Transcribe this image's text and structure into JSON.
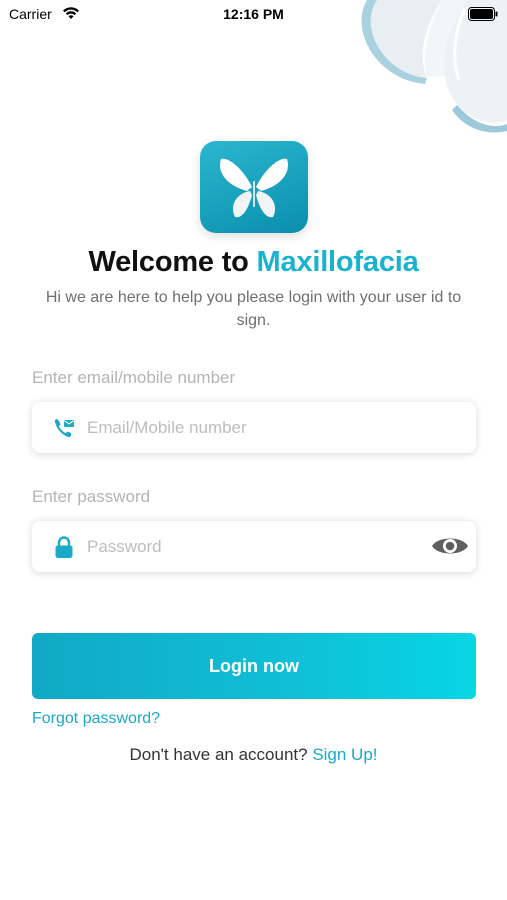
{
  "status_bar": {
    "carrier": "Carrier",
    "time": "12:16 PM"
  },
  "header": {
    "welcome_prefix": "Welcome to ",
    "brand_name": "Maxillofacia",
    "subtitle": "Hi we are here to help you please login with your user id to sign."
  },
  "form": {
    "email_label": "Enter email/mobile number",
    "email_placeholder": "Email/Mobile number",
    "email_value": "",
    "password_label": "Enter password",
    "password_placeholder": "Password",
    "password_value": "",
    "login_button": "Login now",
    "forgot_password": "Forgot password?"
  },
  "footer": {
    "no_account_text": "Don't have an account?",
    "signup_link": "Sign Up!"
  },
  "icons": {
    "email": "phone-mail-icon",
    "password": "lock-icon",
    "visibility": "eye-icon",
    "logo": "butterfly-icon"
  },
  "colors": {
    "accent": "#1ab3cf",
    "link": "#1aa9c6",
    "button_start": "#11a9c5",
    "button_end": "#07d6e4"
  }
}
